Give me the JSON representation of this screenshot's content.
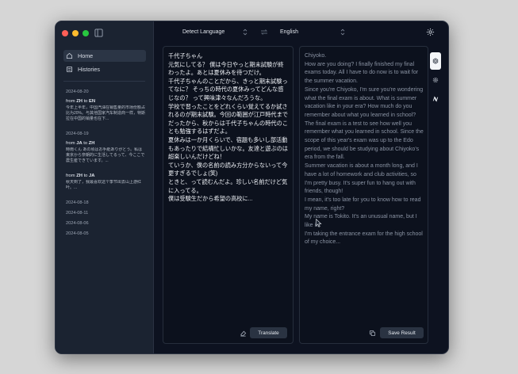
{
  "sidebar": {
    "nav": [
      {
        "label": "Home",
        "icon": "home-icon"
      },
      {
        "label": "Histories",
        "icon": "histories-icon"
      }
    ],
    "history": [
      {
        "date": "2024-08-20",
        "from": "ZH",
        "to": "EN",
        "text": "今年上半年，中国汽油在销售量的市场份额占比为20%。与其他国家汽车制造商一样，特斯拉在中国的销量也在下..."
      },
      {
        "date": "2024-08-19",
        "from": "JA",
        "to": "ZH",
        "text": "時雨くん あの頃はお手紙ありがとう。私は東京から奈朝的に生活してるって、今ここで農生産できています。..."
      },
      {
        "date": "",
        "from": "ZH",
        "to": "JA",
        "text": "秋天到了，我最喜欢这个季节出去山上游红叶。..."
      }
    ],
    "dates": [
      "2024-08-18",
      "2024-08-11",
      "2024-08-06",
      "2024-08-05"
    ]
  },
  "topbar": {
    "source_lang": "Detect Language",
    "target_lang": "English"
  },
  "source": {
    "text": "千代子ちゃん\n元気にしてる？ 僕は今日やっと期末試験が終わったよ。あとは夏休みを待つだけ。\n千代子ちゃんのことだから、きっと期末試験ってなに？ そっちの時代の夏休みってどんな感じなの？ って興味津々なんだろうな。\n学校で習ったことをどれくらい覚えてるか試されるのが期末試験。今回の範囲が江戸時代までだったから、秋からは千代子ちゃんの時代のことも勉強するはずだよ。\n夏休みは一か月くらいで、宿題も多いし部活動もあったりで結構忙しいかな。友達と遊ぶのは超楽しいんだけどね！\nていうか、僕の名前の読み方分からないって今更すぎるでしょ(笑)\nときと、って読むんだよ。珍しい名前だけど気に入ってる。\n僕は受験生だから希望の高校に...",
    "translate_label": "Translate"
  },
  "result": {
    "text": "Chiyoko.\nHow are you doing? I finally finished my final exams today. All I have to do now is to wait for the summer vacation.\nSince you're Chiyoko, I'm sure you're wondering what the final exam is about. What is summer vacation like in your era? How much do you remember about what you learned in school?\nThe final exam is a test to see how well you remember what you learned in school. Since the scope of this year's exam was up to the Edo period, we should be studying about Chiyoko's era from the fall.\nSummer vacation is about a month long, and I have a lot of homework and club activities, so I'm pretty busy. It's super fun to hang out with friends, though!\nI mean, it's too late for you to know how to read my name, right?\nMy name is Tokito. It's an unusual name, but I like it.\nI'm taking the entrance exam for the high school of my choice...",
    "save_label": "Save Result"
  }
}
